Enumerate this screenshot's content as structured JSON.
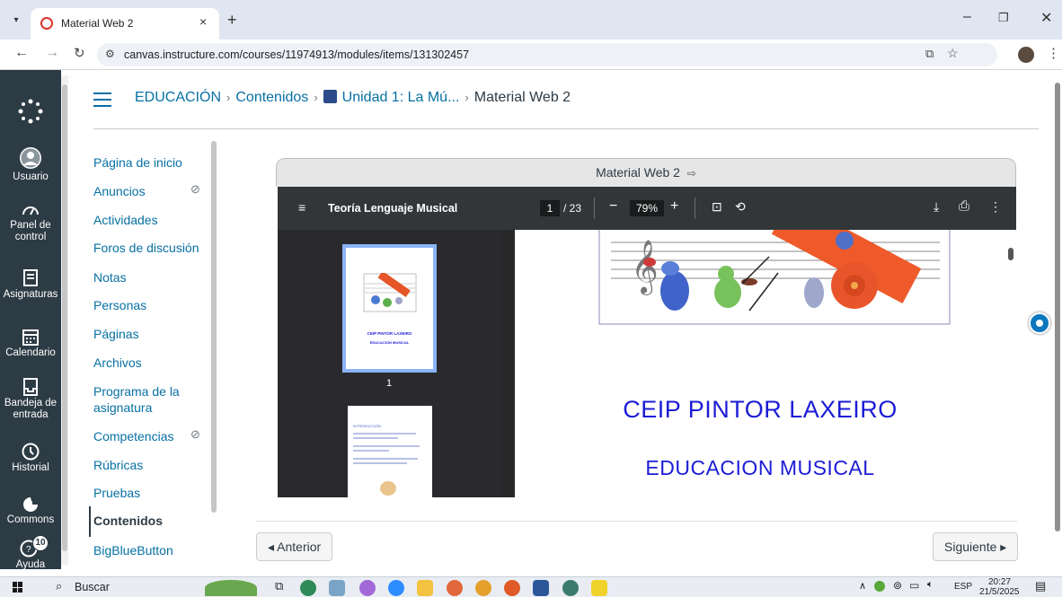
{
  "browser": {
    "tab_title": "Material Web 2",
    "url": "canvas.instructure.com/courses/11974913/modules/items/131302457"
  },
  "global_nav": [
    {
      "label": "Usuario",
      "icon": "user-icon"
    },
    {
      "label": "Panel de control",
      "icon": "dashboard-icon"
    },
    {
      "label": "Asignaturas",
      "icon": "courses-icon"
    },
    {
      "label": "Calendario",
      "icon": "calendar-icon"
    },
    {
      "label": "Bandeja de entrada",
      "icon": "inbox-icon"
    },
    {
      "label": "Historial",
      "icon": "history-icon"
    },
    {
      "label": "Commons",
      "icon": "commons-icon"
    },
    {
      "label": "Ayuda",
      "icon": "help-icon",
      "badge": "10"
    }
  ],
  "breadcrumb": {
    "course": "EDUCACIÓN",
    "section": "Contenidos",
    "module": "Unidad 1: La Mú...",
    "current": "Material Web 2"
  },
  "course_nav": [
    {
      "label": "Página de inicio"
    },
    {
      "label": "Anuncios",
      "hidden": true
    },
    {
      "label": "Actividades"
    },
    {
      "label": "Foros de discusión"
    },
    {
      "label": "Notas"
    },
    {
      "label": "Personas"
    },
    {
      "label": "Páginas"
    },
    {
      "label": "Archivos"
    },
    {
      "label": "Programa de la asignatura"
    },
    {
      "label": "Competencias",
      "hidden": true
    },
    {
      "label": "Rúbricas"
    },
    {
      "label": "Pruebas"
    },
    {
      "label": "Contenidos",
      "active": true
    },
    {
      "label": "BigBlueButton"
    }
  ],
  "viewer": {
    "frame_title": "Material Web 2",
    "doc_title": "Teoría Lenguaje Musical",
    "page_current": "1",
    "page_total": "/ 23",
    "zoom": "79%",
    "thumb1_label": "1",
    "thumb1_line1": "CEIP PINTOR LAXEIRO",
    "thumb1_line2": "EDUCACION MUSICAL",
    "thumb2_heading": "INTRODUCCIÓN",
    "page_line1": "CEIP PINTOR LAXEIRO",
    "page_line2": "EDUCACION MUSICAL"
  },
  "pager": {
    "prev": "◂ Anterior",
    "next": "Siguiente ▸"
  },
  "taskbar": {
    "search": "Buscar",
    "lang": "ESP",
    "time": "20:27",
    "date": "21/5/2025"
  },
  "colors": {
    "canvas_nav": "#2d3b45",
    "link": "#0770a3",
    "pdf_toolbar": "#323639",
    "title_blue": "#1c1cd6"
  }
}
